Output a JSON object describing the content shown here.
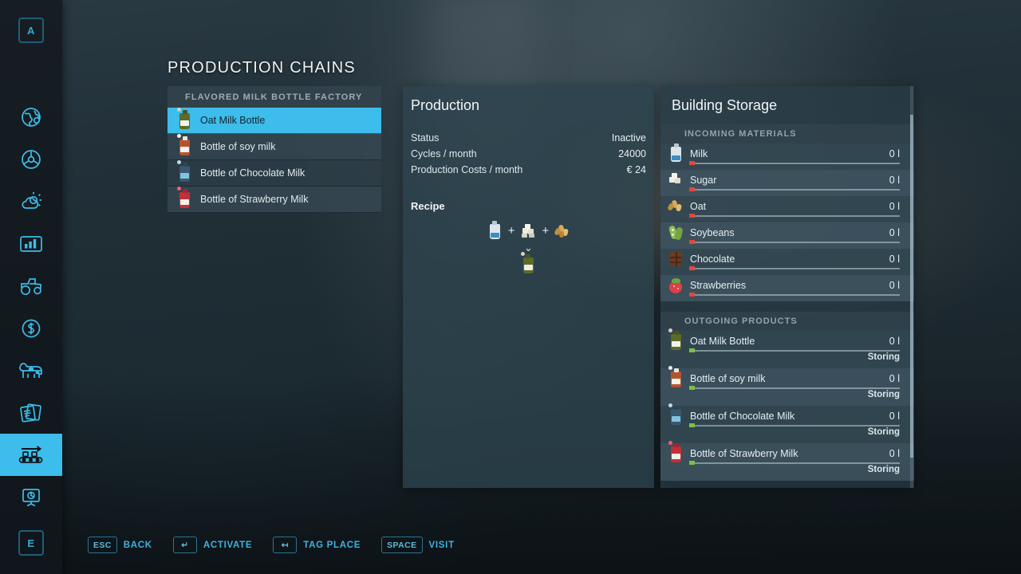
{
  "sidebar": {
    "top_key": "A",
    "bottom_key": "E",
    "items": [
      {
        "name": "map",
        "icon": "globe-icon",
        "active": false
      },
      {
        "name": "vehicles",
        "icon": "steering-wheel-icon",
        "active": false
      },
      {
        "name": "weather",
        "icon": "weather-icon",
        "active": false
      },
      {
        "name": "statistics",
        "icon": "chart-icon",
        "active": false
      },
      {
        "name": "vehicle-list",
        "icon": "tractor-icon",
        "active": false
      },
      {
        "name": "finances",
        "icon": "dollar-icon",
        "active": false
      },
      {
        "name": "animals",
        "icon": "cow-icon",
        "active": false
      },
      {
        "name": "contracts",
        "icon": "documents-icon",
        "active": false
      },
      {
        "name": "production-chains",
        "icon": "conveyor-icon",
        "active": true
      },
      {
        "name": "radio",
        "icon": "monitor-icon",
        "active": false
      }
    ]
  },
  "page_title": "PRODUCTION CHAINS",
  "factory_list": {
    "header": "FLAVORED MILK BOTTLE FACTORY",
    "items": [
      {
        "label": "Oat Milk Bottle",
        "selected": true,
        "bottle": "#5d6b2a",
        "cap": "#b3b7a2",
        "blip": "#cfd4c6"
      },
      {
        "label": "Bottle of soy milk",
        "selected": false,
        "bottle": "#b4542f",
        "cap": "#e8e4d8",
        "blip": "#f2efe4"
      },
      {
        "label": "Bottle of Chocolate Milk",
        "selected": false,
        "bottle": "#3b5870",
        "cap": "#7fc4e2",
        "blip": "#b7dcec"
      },
      {
        "label": "Bottle of Strawberry Milk",
        "selected": false,
        "bottle": "#c2303a",
        "cap": "#e4b7c1",
        "blip": "#ef5f78"
      }
    ]
  },
  "production": {
    "title": "Production",
    "rows": [
      {
        "label": "Status",
        "value": "Inactive"
      },
      {
        "label": "Cycles / month",
        "value": "24000"
      },
      {
        "label": "Production Costs / month",
        "value": "€ 24"
      }
    ],
    "recipe_label": "Recipe",
    "recipe_inputs": [
      {
        "name": "milk",
        "bottle": "#dce6ea",
        "cap": "#b9c6cd",
        "band": "#3a8fc4"
      },
      {
        "name": "sugar",
        "bottle": "#e9e6dd",
        "cap": "#cfcabb",
        "band": "#cfcabb"
      },
      {
        "name": "oat",
        "bottle": "#c99b4e",
        "cap": "#e0bd7c",
        "band": "#b8863d"
      }
    ],
    "recipe_separator": "+",
    "recipe_arrow": "⌄",
    "recipe_output": {
      "name": "oat-milk-bottle",
      "bottle": "#5d6b2a",
      "cap": "#b3b7a2",
      "blip": "#cfd4c6"
    }
  },
  "storage": {
    "title": "Building Storage",
    "incoming_header": "INCOMING MATERIALS",
    "incoming": [
      {
        "label": "Milk",
        "amount": "0 l",
        "fill": 0,
        "dot": "red",
        "bottle": "#dce6ea",
        "cap": "#b9c6cd",
        "band": "#3a8fc4"
      },
      {
        "label": "Sugar",
        "amount": "0 l",
        "fill": 0,
        "dot": "red",
        "bottle": "#e9e6dd",
        "cap": "#cfcabb",
        "band": "#cfcabb"
      },
      {
        "label": "Oat",
        "amount": "0 l",
        "fill": 0,
        "dot": "red",
        "bottle": "#c99b4e",
        "cap": "#e0bd7c",
        "band": "#b8863d"
      },
      {
        "label": "Soybeans",
        "amount": "0 l",
        "fill": 0,
        "dot": "red",
        "bottle": "#8fbf55",
        "cap": "#c8dd9e",
        "band": "#6d9a3c"
      },
      {
        "label": "Chocolate",
        "amount": "0 l",
        "fill": 0,
        "dot": "red",
        "bottle": "#6b3a24",
        "cap": "#8a4c2e",
        "band": "#4e2716"
      },
      {
        "label": "Strawberries",
        "amount": "0 l",
        "fill": 0,
        "dot": "red",
        "bottle": "#de3f48",
        "cap": "#68a83c",
        "band": "#b32c36"
      }
    ],
    "outgoing_header": "OUTGOING PRODUCTS",
    "outgoing": [
      {
        "label": "Oat Milk Bottle",
        "amount": "0 l",
        "fill": 0,
        "dot": "green",
        "status": "Storing",
        "bottle": "#5d6b2a",
        "cap": "#b3b7a2",
        "blip": "#cfd4c6"
      },
      {
        "label": "Bottle of soy milk",
        "amount": "0 l",
        "fill": 0,
        "dot": "green",
        "status": "Storing",
        "bottle": "#b4542f",
        "cap": "#e8e4d8",
        "blip": "#f2efe4"
      },
      {
        "label": "Bottle of Chocolate Milk",
        "amount": "0 l",
        "fill": 0,
        "dot": "green",
        "status": "Storing",
        "bottle": "#3b5870",
        "cap": "#7fc4e2",
        "blip": "#b7dcec"
      },
      {
        "label": "Bottle of Strawberry Milk",
        "amount": "0 l",
        "fill": 0,
        "dot": "green",
        "status": "Storing",
        "bottle": "#c2303a",
        "cap": "#e4b7c1",
        "blip": "#ef5f78"
      }
    ]
  },
  "hints": [
    {
      "key": "ESC",
      "label": "BACK"
    },
    {
      "key": "↵",
      "label": "ACTIVATE"
    },
    {
      "key": "↤",
      "label": "TAG PLACE"
    },
    {
      "key": "SPACE",
      "label": "VISIT"
    }
  ],
  "colors": {
    "accent": "#3dbdeb",
    "hint": "#3fb3dd",
    "panel": "#2d434e",
    "text": "#e6eef2"
  }
}
